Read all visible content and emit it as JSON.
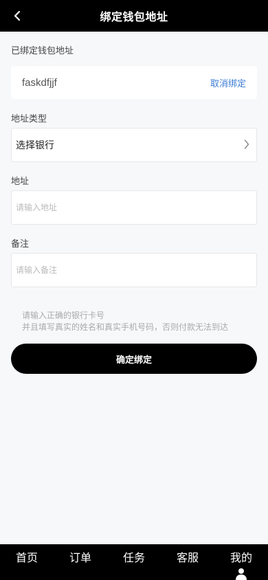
{
  "header": {
    "title": "绑定钱包地址"
  },
  "bound": {
    "label": "已绑定钱包地址",
    "address": "faskdfjjf",
    "unbind_label": "取消绑定"
  },
  "form": {
    "type_label": "地址类型",
    "type_value": "选择银行",
    "address_label": "地址",
    "address_placeholder": "请输入地址",
    "note_label": "备注",
    "note_placeholder": "请输入备注"
  },
  "hint": {
    "line1": "请输入正确的银行卡号",
    "line2": "并且填写真实的姓名和真实手机号码，否则付款无法到达"
  },
  "confirm_label": "确定绑定",
  "tabs": [
    {
      "label": "首页"
    },
    {
      "label": "订单"
    },
    {
      "label": "任务"
    },
    {
      "label": "客服"
    },
    {
      "label": "我的"
    }
  ],
  "colors": {
    "accent": "#3a7bd5",
    "header_bg": "#000000",
    "page_bg": "#f7f8fa"
  },
  "icons": {
    "back": "chevron-left-icon",
    "select": "chevron-right-icon",
    "profile": "user-icon"
  }
}
